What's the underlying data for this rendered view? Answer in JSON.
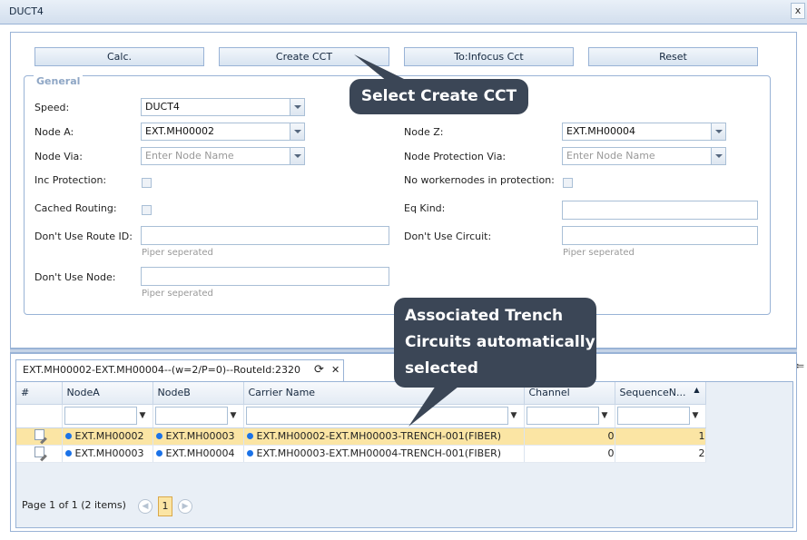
{
  "window": {
    "title": "DUCT4",
    "close_label": "x"
  },
  "toolbar": {
    "calc": "Calc.",
    "create_cct": "Create CCT",
    "to_infocus": "To:Infocus Cct",
    "reset": "Reset"
  },
  "general": {
    "legend": "General",
    "speed_label": "Speed:",
    "speed_value": "DUCT4",
    "node_a_label": "Node A:",
    "node_a_value": "EXT.MH00002",
    "node_z_label": "Node Z:",
    "node_z_value": "EXT.MH00004",
    "node_via_label": "Node Via:",
    "node_via_placeholder": "Enter Node Name",
    "node_prot_via_label": "Node Protection Via:",
    "node_prot_via_placeholder": "Enter Node Name",
    "inc_protection_label": "Inc Protection:",
    "no_workernodes_label": "No workernodes in protection:",
    "cached_routing_label": "Cached Routing:",
    "eq_kind_label": "Eq Kind:",
    "dont_use_route_label": "Don't Use Route ID:",
    "dont_use_route_hint": "Piper seperated",
    "dont_use_circuit_label": "Don't Use Circuit:",
    "dont_use_circuit_hint": "Piper seperated",
    "dont_use_node_label": "Don't Use Node:",
    "dont_use_node_hint": "Piper seperated"
  },
  "callouts": {
    "create": "Select Create CCT",
    "trench_1": "Associated Trench",
    "trench_2": "Circuits automatically",
    "trench_3": "selected"
  },
  "tab": {
    "label": "EXT.MH00002-EXT.MH00004--(w=2/P=0)--RouteId:2320",
    "refresh_icon": "⟳",
    "close_icon": "✕"
  },
  "grid": {
    "headers": {
      "num": "#",
      "node_a": "NodeA",
      "node_b": "NodeB",
      "carrier": "Carrier Name",
      "channel": "Channel",
      "seq": "SequenceN..."
    },
    "rows": [
      {
        "node_a": "EXT.MH00002",
        "node_b": "EXT.MH00003",
        "carrier": "EXT.MH00002-EXT.MH00003-TRENCH-001(FIBER)",
        "channel": "0",
        "seq": "1"
      },
      {
        "node_a": "EXT.MH00003",
        "node_b": "EXT.MH00004",
        "carrier": "EXT.MH00003-EXT.MH00004-TRENCH-001(FIBER)",
        "channel": "0",
        "seq": "2"
      }
    ]
  },
  "pager": {
    "text": "Page 1 of 1 (2 items)",
    "current": "1"
  },
  "colors": {
    "selected_row": "#fbe5a4",
    "callout": "#3b4656",
    "border": "#99b3d6"
  }
}
